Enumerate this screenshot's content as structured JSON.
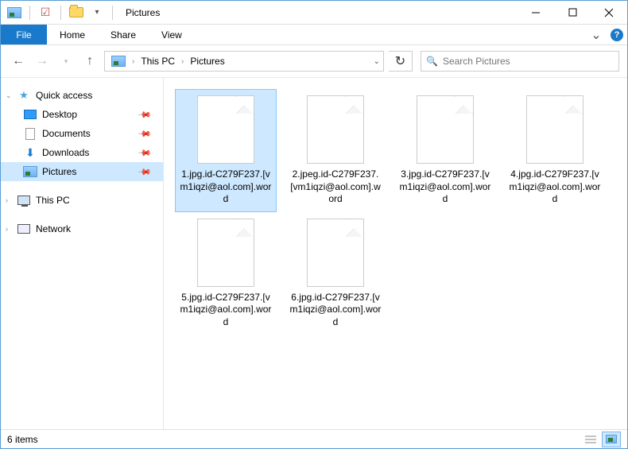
{
  "window_title": "Pictures",
  "ribbon": {
    "file": "File",
    "tabs": [
      "Home",
      "Share",
      "View"
    ]
  },
  "breadcrumb": {
    "root": "This PC",
    "current": "Pictures"
  },
  "search": {
    "placeholder": "Search Pictures"
  },
  "sidebar": {
    "quick_access": {
      "label": "Quick access"
    },
    "items": [
      {
        "label": "Desktop",
        "pinned": true
      },
      {
        "label": "Documents",
        "pinned": true
      },
      {
        "label": "Downloads",
        "pinned": true
      },
      {
        "label": "Pictures",
        "pinned": true,
        "selected": true
      }
    ],
    "this_pc": {
      "label": "This PC"
    },
    "network": {
      "label": "Network"
    }
  },
  "files": [
    {
      "name": "1.jpg.id-C279F237.[vm1iqzi@aol.com].word",
      "selected": true
    },
    {
      "name": "2.jpeg.id-C279F237.[vm1iqzi@aol.com].word"
    },
    {
      "name": "3.jpg.id-C279F237.[vm1iqzi@aol.com].word"
    },
    {
      "name": "4.jpg.id-C279F237.[vm1iqzi@aol.com].word"
    },
    {
      "name": "5.jpg.id-C279F237.[vm1iqzi@aol.com].word"
    },
    {
      "name": "6.jpg.id-C279F237.[vm1iqzi@aol.com].word"
    }
  ],
  "status": {
    "count_label": "6 items"
  }
}
